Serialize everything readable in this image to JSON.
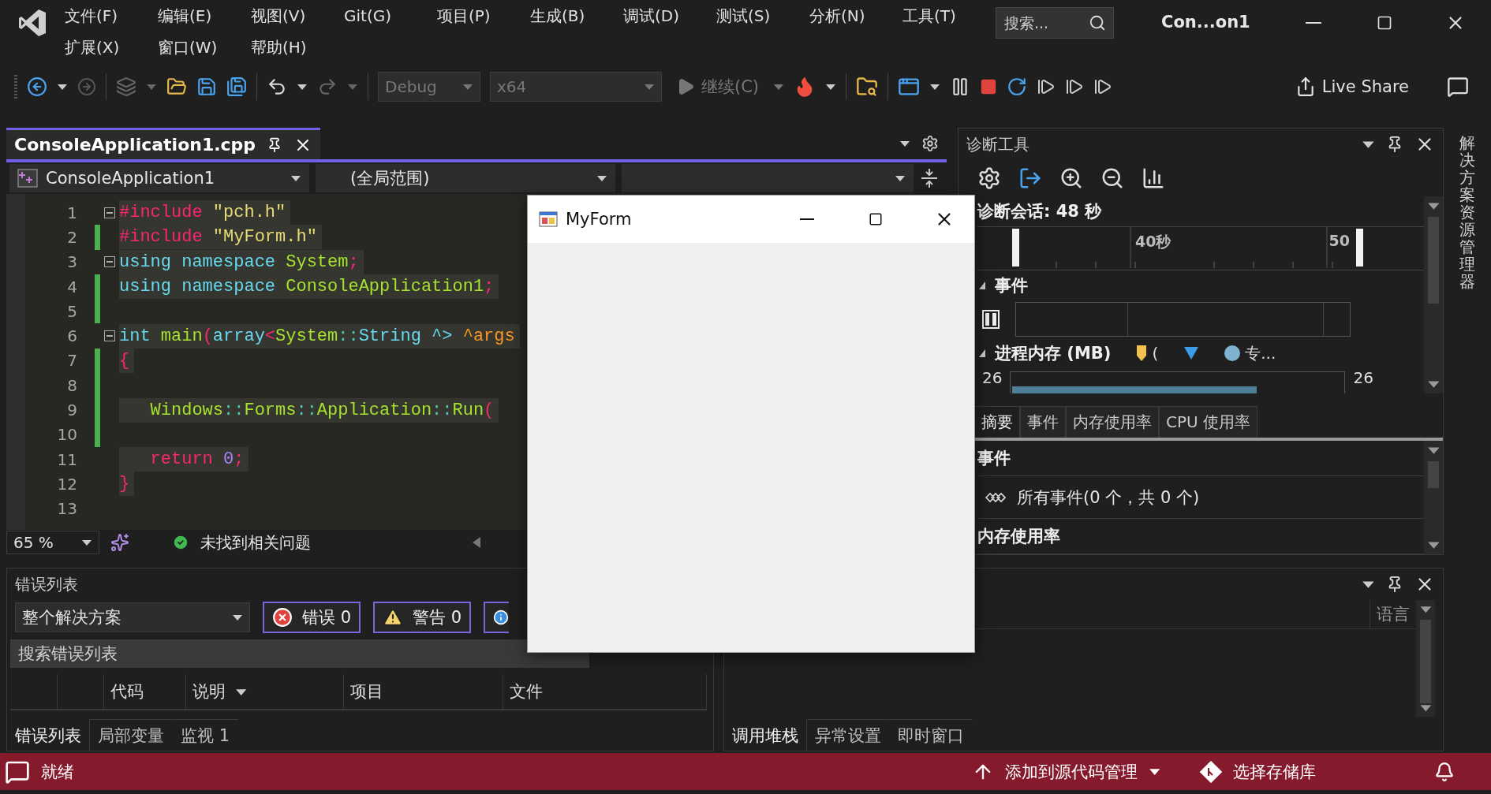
{
  "title_bar": {
    "menus": [
      "文件(F)",
      "编辑(E)",
      "视图(V)",
      "Git(G)",
      "项目(P)",
      "生成(B)",
      "调试(D)",
      "测试(S)",
      "分析(N)",
      "工具(T)",
      "扩展(X)",
      "窗口(W)",
      "帮助(H)"
    ],
    "search": {
      "placeholder": "搜索..."
    },
    "title": "Con...on1"
  },
  "toolbar": {
    "configuration": "Debug",
    "platform": "x64",
    "continue": "继续(C)",
    "live_share": "Live Share"
  },
  "editor": {
    "tab": {
      "title": "ConsoleApplication1.cpp",
      "selected": true
    },
    "project": "ConsoleApplication1",
    "scope": "(全局范围)",
    "lines": [
      {
        "number": "1",
        "changed": false,
        "fold": true,
        "tokens": [
          {
            "text": "#include",
            "kind": "pre"
          },
          {
            "text": " \"pch.h\"",
            "kind": "str"
          }
        ]
      },
      {
        "number": "2",
        "changed": true,
        "fold": false,
        "tokens": [
          {
            "text": "#include",
            "kind": "pre"
          },
          {
            "text": " \"MyForm.h\"",
            "kind": "str"
          }
        ]
      },
      {
        "number": "3",
        "changed": false,
        "fold": true,
        "tokens": [
          {
            "text": "using namespace",
            "kind": "kw"
          },
          {
            "text": " System",
            "kind": "type"
          },
          {
            "text": ";",
            "kind": "punc"
          }
        ]
      },
      {
        "number": "4",
        "changed": true,
        "fold": false,
        "tokens": [
          {
            "text": "using namespace",
            "kind": "kw"
          },
          {
            "text": " ConsoleApplication1",
            "kind": "type"
          },
          {
            "text": ";",
            "kind": "punc"
          }
        ]
      },
      {
        "number": "5",
        "changed": true,
        "fold": false
      },
      {
        "number": "6",
        "changed": false,
        "fold": true,
        "tokens": [
          {
            "text": "int",
            "kind": "kw"
          },
          {
            "text": " main",
            "kind": "type"
          },
          {
            "text": "(",
            "kind": "punc"
          },
          {
            "text": "array",
            "kind": "kw"
          },
          {
            "text": "<",
            "kind": "punc"
          },
          {
            "text": "System",
            "kind": "type"
          },
          {
            "text": "::",
            "kind": "op"
          },
          {
            "text": "String ^>",
            "kind": "kw"
          },
          {
            "text": " ^args",
            "kind": "param"
          }
        ]
      },
      {
        "number": "7",
        "changed": true,
        "fold": false,
        "tokens": [
          {
            "text": "{",
            "kind": "punc"
          }
        ]
      },
      {
        "number": "8",
        "changed": true,
        "fold": false
      },
      {
        "number": "9",
        "changed": true,
        "fold": false,
        "tokens": [
          {
            "text": "   Windows",
            "kind": "type"
          },
          {
            "text": "::",
            "kind": "op"
          },
          {
            "text": "Forms",
            "kind": "type"
          },
          {
            "text": "::",
            "kind": "op"
          },
          {
            "text": "Application",
            "kind": "type"
          },
          {
            "text": "::",
            "kind": "op"
          },
          {
            "text": "Run",
            "kind": "type"
          },
          {
            "text": "(",
            "kind": "punc"
          }
        ]
      },
      {
        "number": "10",
        "changed": true,
        "fold": false
      },
      {
        "number": "11",
        "changed": false,
        "fold": false,
        "tokens": [
          {
            "text": "   return",
            "kind": "punc"
          },
          {
            "text": " 0",
            "kind": "num"
          },
          {
            "text": ";",
            "kind": "punc"
          }
        ]
      },
      {
        "number": "12",
        "changed": false,
        "fold": false,
        "tokens": [
          {
            "text": "}",
            "kind": "punc"
          }
        ]
      },
      {
        "number": "13",
        "changed": false,
        "fold": false
      }
    ],
    "zoom": "65 %",
    "status": "未找到相关问题"
  },
  "diagnostics": {
    "title": "诊断工具",
    "session": "诊断会话: 48 秒",
    "ruler_labels": [
      "40秒",
      "50"
    ],
    "events_section": {
      "title": "事件",
      "expanded": true
    },
    "memory_section": {
      "title": "进程内存 (MB)",
      "expanded": true,
      "min": "26",
      "max": "26"
    },
    "legend": [
      {
        "kind": "shield",
        "color": "#f2c14e",
        "text": "("
      },
      {
        "kind": "triangle",
        "color": "#3d9be9"
      },
      {
        "kind": "circle",
        "color": "#7fb3d0",
        "text": "专..."
      }
    ],
    "tabs": [
      {
        "label": "摘要",
        "selected": true
      },
      {
        "label": "事件",
        "selected": false
      },
      {
        "label": "内存使用率",
        "selected": false
      },
      {
        "label": "CPU 使用率",
        "selected": false
      }
    ],
    "summary_events_heading": "事件",
    "all_events": "所有事件(0 个，共 0 个)",
    "memory_usage_heading": "内存使用率"
  },
  "error_list": {
    "title": "错误列表",
    "scope": "整个解决方案",
    "filters": [
      {
        "kind": "error",
        "label": "错误 0",
        "on": true
      },
      {
        "kind": "warning",
        "label": "警告 0",
        "on": true
      },
      {
        "kind": "info",
        "on": true
      }
    ],
    "search": {
      "placeholder": "搜索错误列表"
    },
    "columns": [
      {
        "label": "代码",
        "sorted": false
      },
      {
        "label": "说明",
        "sorted": true
      },
      {
        "label": "项目",
        "sorted": false
      },
      {
        "label": "文件",
        "sorted": false
      }
    ],
    "tabs": [
      {
        "label": "错误列表",
        "selected": true
      },
      {
        "label": "局部变量",
        "selected": false
      },
      {
        "label": "监视 1",
        "selected": false
      }
    ]
  },
  "call_stack": {
    "columns": [
      "语言"
    ],
    "tabs": [
      {
        "label": "调用堆栈",
        "selected": true
      },
      {
        "label": "异常设置",
        "selected": false
      },
      {
        "label": "即时窗口",
        "selected": false
      }
    ]
  },
  "side_strip": {
    "label": "解决方案资源管理器"
  },
  "form_window": {
    "title": "MyForm"
  },
  "status_bar": {
    "ready": "就绪",
    "source_control": "添加到源代码管理",
    "repository": "选择存储库"
  }
}
